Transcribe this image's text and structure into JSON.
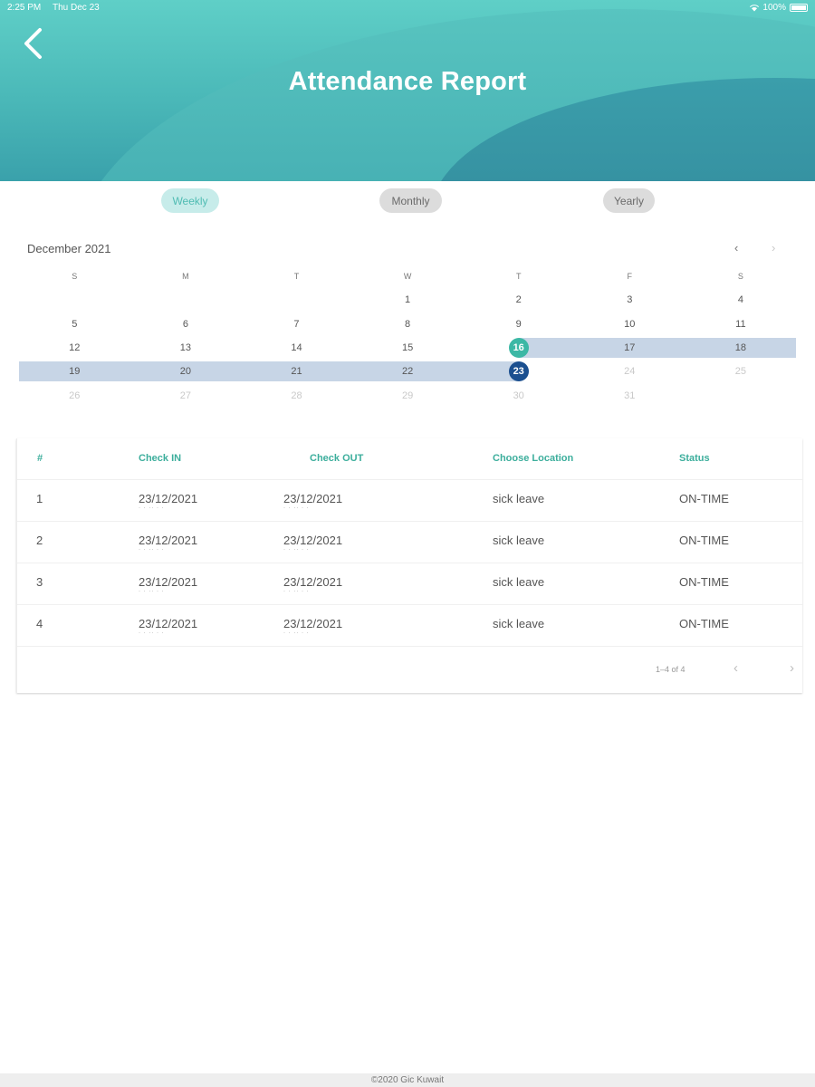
{
  "status_bar": {
    "time": "2:25 PM",
    "date": "Thu Dec 23",
    "battery": "100%"
  },
  "header": {
    "title": "Attendance Report",
    "back_icon": "chevron-left-icon"
  },
  "period_tabs": [
    {
      "label": "Weekly",
      "selected": true
    },
    {
      "label": "Monthly",
      "selected": false
    },
    {
      "label": "Yearly",
      "selected": false
    }
  ],
  "calendar": {
    "month_label": "December 2021",
    "weekdays": [
      "S",
      "M",
      "T",
      "W",
      "T",
      "F",
      "S"
    ],
    "weeks": [
      [
        "",
        "",
        "",
        "1",
        "2",
        "3",
        "4"
      ],
      [
        "5",
        "6",
        "7",
        "8",
        "9",
        "10",
        "11"
      ],
      [
        "12",
        "13",
        "14",
        "15",
        "16",
        "17",
        "18"
      ],
      [
        "19",
        "20",
        "21",
        "22",
        "23",
        "24",
        "25"
      ],
      [
        "26",
        "27",
        "28",
        "29",
        "30",
        "31",
        ""
      ]
    ],
    "range_start": "16",
    "range_end": "23",
    "colors": {
      "range": "#c7d5e6",
      "start": "#3cb8a5",
      "end": "#1b4f8f"
    }
  },
  "table": {
    "columns": [
      "#",
      "Check IN",
      "Check OUT",
      "Choose Location",
      "Status"
    ],
    "rows": [
      {
        "num": "1",
        "check_in": "23/12/2021",
        "check_out": "23/12/2021",
        "location": "sick leave",
        "status": "ON-TIME"
      },
      {
        "num": "2",
        "check_in": "23/12/2021",
        "check_out": "23/12/2021",
        "location": "sick leave",
        "status": "ON-TIME"
      },
      {
        "num": "3",
        "check_in": "23/12/2021",
        "check_out": "23/12/2021",
        "location": "sick leave",
        "status": "ON-TIME"
      },
      {
        "num": "4",
        "check_in": "23/12/2021",
        "check_out": "23/12/2021",
        "location": "sick leave",
        "status": "ON-TIME"
      }
    ],
    "pagination": {
      "range": "1–4 of 4"
    }
  },
  "footer": {
    "text": "©2020 Gic Kuwait"
  }
}
